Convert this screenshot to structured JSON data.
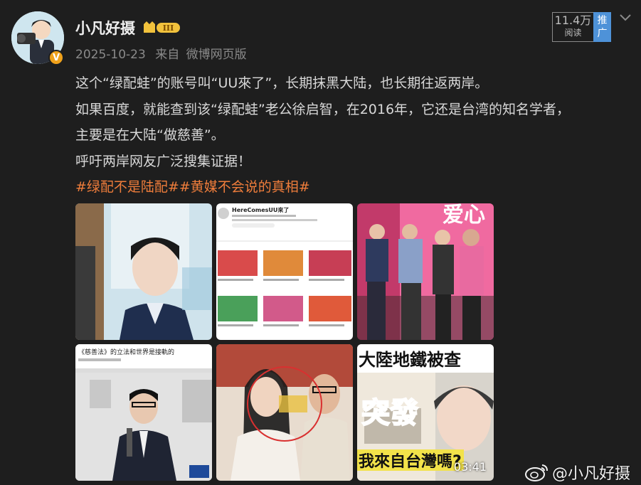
{
  "author": {
    "name": "小凡好摄",
    "level_badge": "III",
    "verified_badge": "V"
  },
  "post_meta": {
    "date": "2025-10-23",
    "source_prefix": "来自",
    "source": "微博网页版"
  },
  "stats": {
    "read_count": "11.4万",
    "read_label": "阅读",
    "promote_label": "推广"
  },
  "content": {
    "lines": [
      "这个“绿配蛙”的账号叫“UU來了”，长期抹黑大陆，也长期往返两岸。",
      "如果百度，就能查到该“绿配蛙”老公徐启智，在2016年，它还是台湾的知名学者，",
      "主要是在大陆“做慈善”。",
      "呼吁两岸网友广泛搜集证据！"
    ],
    "hashtags": [
      "#绿配不是陆配#",
      "#黄媒不会说的真相#"
    ]
  },
  "images": [
    {
      "id": "img1"
    },
    {
      "id": "img2",
      "channel_title": "HereComesUU來了"
    },
    {
      "id": "img3",
      "banner_text": "爱心"
    },
    {
      "id": "img4",
      "header_text": "《慈善法》的立法和世界是接軌的"
    },
    {
      "id": "img5"
    },
    {
      "id": "img6",
      "caption_top": "大陸地鐵被查",
      "caption_mid": "突發",
      "caption_bottom": "我來自台灣嗎?",
      "duration": "03:41"
    }
  ],
  "watermark": {
    "handle": "@小凡好摄"
  },
  "colors": {
    "background": "#1e1e1e",
    "hashtag": "#ef7d3b",
    "promote": "#4e92d8",
    "badge_gold": "#f0a21b"
  }
}
